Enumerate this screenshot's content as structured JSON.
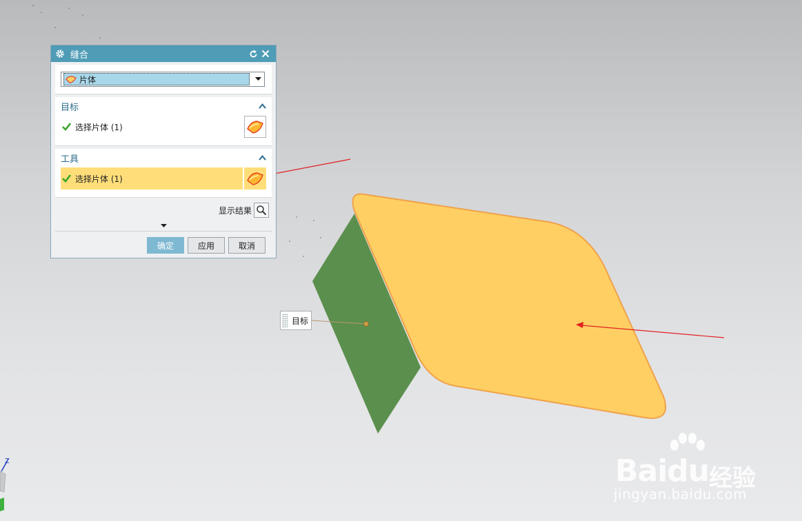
{
  "dialog": {
    "title": "缝合",
    "type_select": {
      "value": "片体"
    },
    "target_section": {
      "header": "目标",
      "select_label": "选择片体 (1)"
    },
    "tool_section": {
      "header": "工具",
      "select_label": "选择片体 (1)"
    },
    "show_result_label": "显示结果",
    "buttons": {
      "ok": "确定",
      "apply": "应用",
      "cancel": "取消"
    }
  },
  "viewport": {
    "target_tag": "目标",
    "axis_label": "Z",
    "colors": {
      "tool_sheet": "#ffcf63",
      "tool_edge": "#f0a24a",
      "target_sheet": "#5b8f4d",
      "arrow": "#e02020"
    }
  },
  "watermark": {
    "brand": "Baidu",
    "brand_cn": "经验",
    "url": "jingyan.baidu.com"
  }
}
